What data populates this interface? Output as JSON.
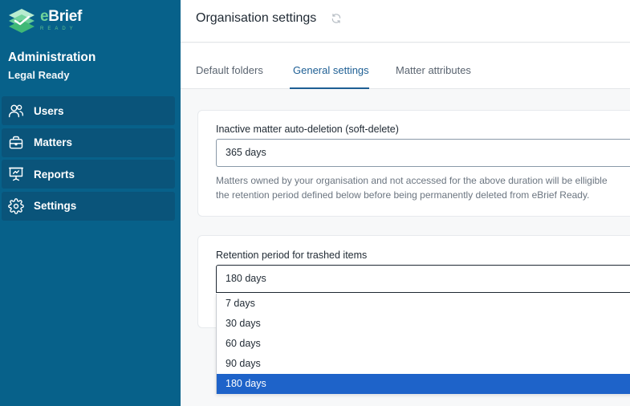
{
  "sidebar": {
    "logo": {
      "main_e": "e",
      "main_rest": "Brief",
      "sub": "READY"
    },
    "org_title": "Administration",
    "org_subtitle": "Legal Ready",
    "items": [
      {
        "label": "Users",
        "icon": "users-icon"
      },
      {
        "label": "Matters",
        "icon": "briefcase-icon"
      },
      {
        "label": "Reports",
        "icon": "presentation-chart-icon"
      },
      {
        "label": "Settings",
        "icon": "gear-icon"
      }
    ]
  },
  "header": {
    "title": "Organisation settings",
    "refresh_icon": "refresh-icon"
  },
  "tabs": [
    {
      "label": "Default folders",
      "active": false
    },
    {
      "label": "General settings",
      "active": true
    },
    {
      "label": "Matter attributes",
      "active": false
    }
  ],
  "auto_deletion": {
    "label": "Inactive matter auto-deletion (soft-delete)",
    "value": "365 days",
    "help_line1": "Matters owned by your organisation and not accessed for the above duration will be elligible",
    "help_line2": "the retention period defined below before being permanently deleted from eBrief Ready."
  },
  "retention": {
    "label": "Retention period for trashed items",
    "value": "180 days",
    "options": [
      "7 days",
      "30 days",
      "60 days",
      "90 days",
      "180 days"
    ],
    "selected_index": 4
  },
  "colors": {
    "sidebar": "#07618a",
    "nav_item": "#0a547a",
    "accent": "#1e5f94",
    "selected_option": "#1e63c9",
    "logo_green": "#6fd39a"
  }
}
